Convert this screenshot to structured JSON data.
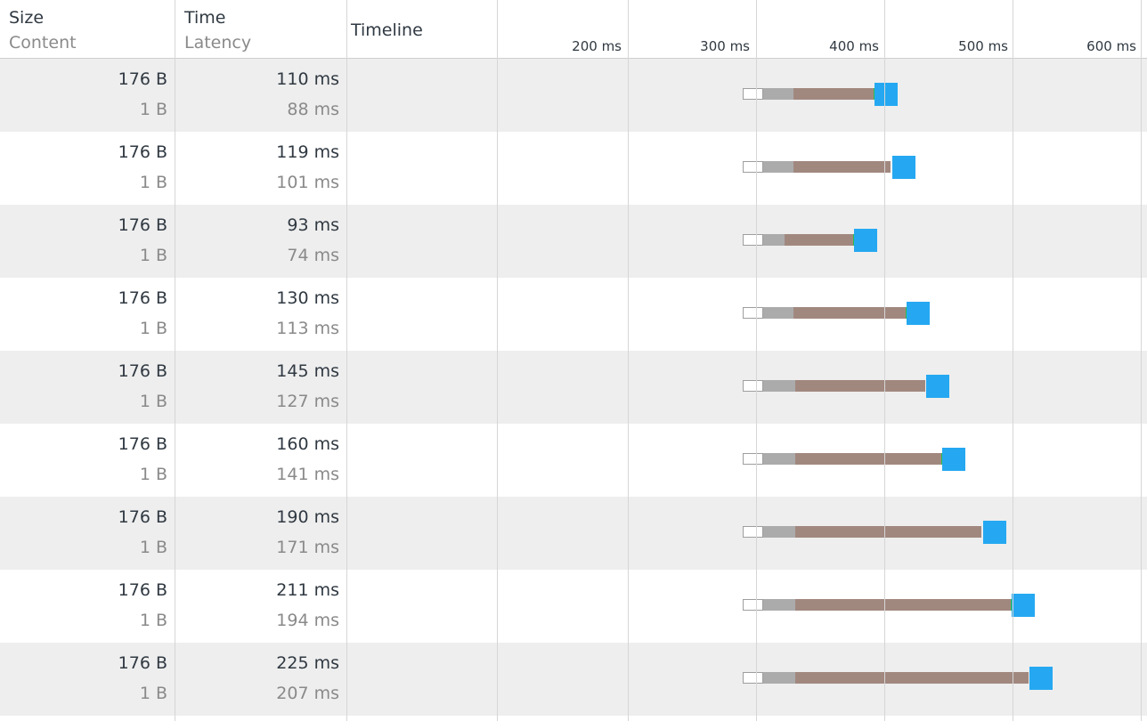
{
  "header": {
    "size_label": "Size",
    "content_label": "Content",
    "time_label": "Time",
    "latency_label": "Latency",
    "timeline_label": "Timeline",
    "ticks": [
      "200 ms",
      "300 ms",
      "400 ms",
      "500 ms",
      "600 ms"
    ]
  },
  "colors": {
    "stalled_border": "#9e9e9e",
    "connecting": "#ababab",
    "waiting": "#a1887f",
    "ssl": "#2dbd4e",
    "receiving": "#25a8f1",
    "row_alt": "#eeeeee"
  },
  "rows": [
    {
      "size": "176 B",
      "content": "1 B",
      "time": "110 ms",
      "latency": "88 ms",
      "ssl_marker": true
    },
    {
      "size": "176 B",
      "content": "1 B",
      "time": "119 ms",
      "latency": "101 ms",
      "ssl_marker": false
    },
    {
      "size": "176 B",
      "content": "1 B",
      "time": "93 ms",
      "latency": "74 ms",
      "ssl_marker": true
    },
    {
      "size": "176 B",
      "content": "1 B",
      "time": "130 ms",
      "latency": "113 ms",
      "ssl_marker": true
    },
    {
      "size": "176 B",
      "content": "1 B",
      "time": "145 ms",
      "latency": "127 ms",
      "ssl_marker": false
    },
    {
      "size": "176 B",
      "content": "1 B",
      "time": "160 ms",
      "latency": "141 ms",
      "ssl_marker": true
    },
    {
      "size": "176 B",
      "content": "1 B",
      "time": "190 ms",
      "latency": "171 ms",
      "ssl_marker": false
    },
    {
      "size": "176 B",
      "content": "1 B",
      "time": "211 ms",
      "latency": "194 ms",
      "ssl_marker": true
    },
    {
      "size": "176 B",
      "content": "1 B",
      "time": "225 ms",
      "latency": "207 ms",
      "ssl_marker": false
    }
  ]
}
